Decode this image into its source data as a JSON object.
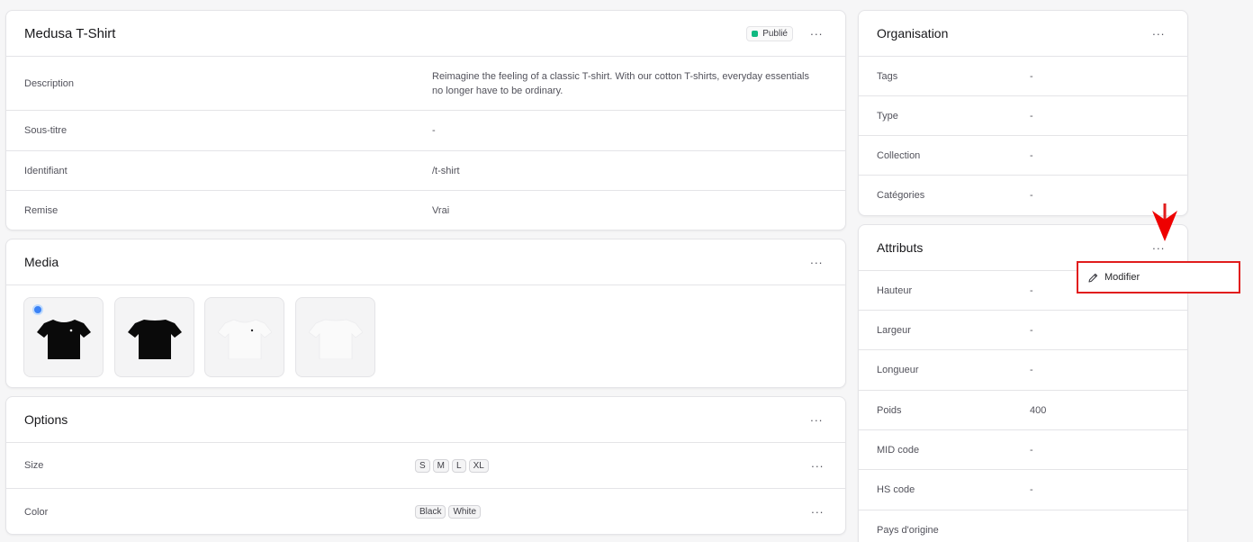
{
  "product": {
    "title": "Medusa T-Shirt",
    "status": "Publié",
    "rows": [
      {
        "label": "Description",
        "value": "Reimagine the feeling of a classic T-shirt. With our cotton T-shirts, everyday essentials no longer have to be ordinary."
      },
      {
        "label": "Sous-titre",
        "value": "-"
      },
      {
        "label": "Identifiant",
        "value": "/t-shirt"
      },
      {
        "label": "Remise",
        "value": "Vrai"
      }
    ]
  },
  "media": {
    "title": "Media",
    "thumbnails": [
      "black-tshirt-front",
      "black-tshirt-back",
      "white-tshirt-front",
      "white-tshirt-back"
    ]
  },
  "options": {
    "title": "Options",
    "items": [
      {
        "label": "Size",
        "values": [
          "S",
          "M",
          "L",
          "XL"
        ]
      },
      {
        "label": "Color",
        "values": [
          "Black",
          "White"
        ]
      }
    ]
  },
  "organisation": {
    "title": "Organisation",
    "rows": [
      {
        "label": "Tags",
        "value": "-"
      },
      {
        "label": "Type",
        "value": "-"
      },
      {
        "label": "Collection",
        "value": "-"
      },
      {
        "label": "Catégories",
        "value": "-"
      }
    ]
  },
  "attributes": {
    "title": "Attributs",
    "rows": [
      {
        "label": "Hauteur",
        "value": "-"
      },
      {
        "label": "Largeur",
        "value": "-"
      },
      {
        "label": "Longueur",
        "value": "-"
      },
      {
        "label": "Poids",
        "value": "400"
      },
      {
        "label": "MID code",
        "value": "-"
      },
      {
        "label": "HS code",
        "value": "-"
      },
      {
        "label": "Pays d'origine",
        "value": ""
      }
    ]
  },
  "menu": {
    "edit_label": "Modifier",
    "edit_icon": "pencil-icon"
  },
  "more_icon_glyph": "···",
  "colors": {
    "status_published": "#10b981",
    "highlight": "#e11d1d"
  }
}
